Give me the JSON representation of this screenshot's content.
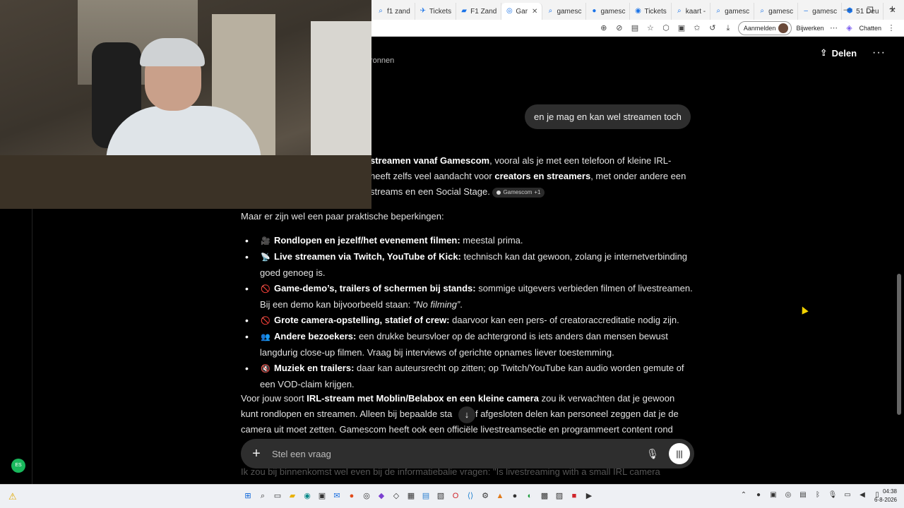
{
  "browser": {
    "tabs": [
      {
        "label": "f1 zand",
        "icon": "search-icon",
        "active": false
      },
      {
        "label": "Tickets",
        "icon": "ticket-icon",
        "active": false
      },
      {
        "label": "F1 Zand",
        "icon": "f1-icon",
        "active": false
      },
      {
        "label": "Gar",
        "icon": "chatgpt-icon",
        "active": true
      },
      {
        "label": "gamesc",
        "icon": "search-icon",
        "active": false
      },
      {
        "label": "gamesc",
        "icon": "map-pin-icon",
        "active": false
      },
      {
        "label": "Tickets",
        "icon": "location-icon",
        "active": false
      },
      {
        "label": "kaart -",
        "icon": "search-icon",
        "active": false
      },
      {
        "label": "gamesc",
        "icon": "search-icon",
        "active": false
      },
      {
        "label": "gamesc",
        "icon": "search-icon",
        "active": false
      },
      {
        "label": "gamesc",
        "icon": "dash-icon",
        "active": false
      },
      {
        "label": "51 Deu",
        "icon": "maps-icon",
        "active": false
      }
    ],
    "signin_label": "Aanmelden",
    "update_label": "Bijwerken",
    "chat_label": "Chatten"
  },
  "page": {
    "share_label": "Delen",
    "sources_label": "ronnen",
    "user_message": "en je mag en kan wel streamen toch",
    "para1": {
      "b1": "streamen vanaf Gamescom",
      "t1": ", vooral als je met een telefoon of kleine IRL-",
      "t2": "heeft zelfs veel aandacht voor ",
      "b2": "creators en streamers",
      "t3": ", met onder andere een",
      "t4": "streams en een Social Stage.",
      "cite_label": "Gamescom",
      "cite_count": "+1"
    },
    "para2": "Maar er zijn wel een paar praktische beperkingen:",
    "bullets": [
      {
        "emoji": "🎥",
        "bold": "Rondlopen en jezelf/het evenement filmen:",
        "text": " meestal prima."
      },
      {
        "emoji": "📡",
        "bold": "Live streamen via Twitch, YouTube of Kick:",
        "text": " technisch kan dat gewoon, zolang je internetverbinding goed genoeg is."
      },
      {
        "emoji": "🚫",
        "bold": "Game-demo’s, trailers of schermen bij stands:",
        "text": " sommige uitgevers verbieden filmen of livestreamen. Bij een demo kan bijvoorbeeld staan: ",
        "italic": "“No filming”",
        "tail": "."
      },
      {
        "emoji": "🚫",
        "bold": "Grote camera-opstelling, statief of crew:",
        "text": " daarvoor kan een pers- of creatoraccreditatie nodig zijn."
      },
      {
        "emoji": "👥",
        "bold": "Andere bezoekers:",
        "text": " een drukke beursvloer op de achtergrond is iets anders dan mensen bewust langdurig close-up filmen. Vraag bij interviews of gerichte opnames liever toestemming."
      },
      {
        "emoji": "🔇",
        "bold": "Muziek en trailers:",
        "text": " daar kan auteursrecht op zitten; op Twitch/YouTube kan audio worden gemute of een VOD-claim krijgen."
      }
    ],
    "para3": {
      "t1": "Voor jouw soort ",
      "b1": "IRL-stream met Moblin/Belabox en een kleine camera",
      "t2": " zou ik verwachten dat je gewoon kunt rondlopen en streamen. Alleen bij bepaalde sta",
      "t3": " of afgesloten delen kan personeel zeggen dat je de camera uit moet zetten. Gamescom heeft ook een officiële livestreamsectie en programmeert content rond"
    },
    "faded_line": "Ik zou bij binnenkomst wel even bij de informatiebalie vragen: \"Is livestreaming with a small IRL camera",
    "composer_placeholder": "Stel een vraag",
    "rail_avatar": "ES"
  },
  "taskbar": {
    "time": "04:38",
    "date": "6-8-2026"
  }
}
